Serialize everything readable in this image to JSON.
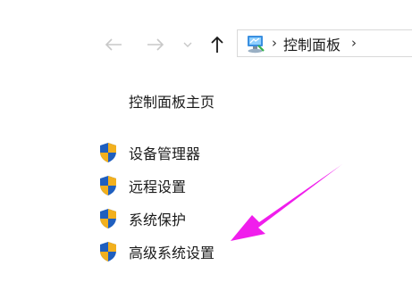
{
  "nav": {
    "back_icon": "arrow-left-icon",
    "forward_icon": "arrow-right-icon",
    "recent_icon": "chevron-down-icon",
    "up_icon": "arrow-up-icon"
  },
  "address_bar": {
    "location_icon": "control-panel-icon",
    "breadcrumb_separator": "›",
    "crumb": "控制面板"
  },
  "sidebar": {
    "home_label": "控制面板主页",
    "items": [
      {
        "label": "设备管理器",
        "icon": "uac-shield-icon"
      },
      {
        "label": "远程设置",
        "icon": "uac-shield-icon"
      },
      {
        "label": "系统保护",
        "icon": "uac-shield-icon"
      },
      {
        "label": "高级系统设置",
        "icon": "uac-shield-icon"
      }
    ]
  },
  "annotation": {
    "arrow_color": "#f01eec",
    "target": "高级系统设置"
  },
  "colors": {
    "shield_blue": "#1f5fbf",
    "shield_yellow": "#f2b01e",
    "nav_disabled": "#c8c8c8",
    "nav_enabled": "#1a1a1a"
  }
}
